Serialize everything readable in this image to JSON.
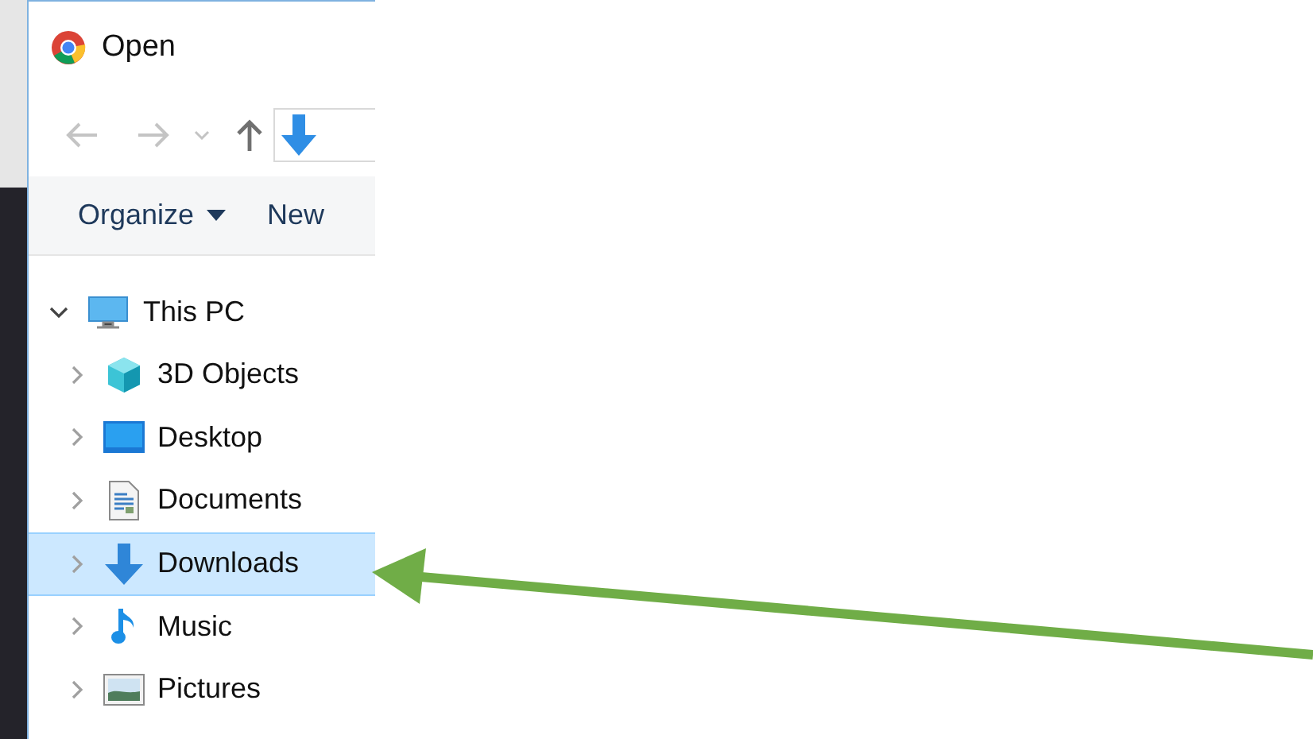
{
  "window": {
    "title": "Open"
  },
  "toolbar": {
    "organize": "Organize",
    "new_folder": "New"
  },
  "tree": [
    {
      "label": "This PC",
      "expanded": true,
      "children": [
        {
          "label": "3D Objects",
          "expanded": false,
          "selected": false
        },
        {
          "label": "Desktop",
          "expanded": false,
          "selected": false
        },
        {
          "label": "Documents",
          "expanded": false,
          "selected": false
        },
        {
          "label": "Downloads",
          "expanded": false,
          "selected": true
        },
        {
          "label": "Music",
          "expanded": false,
          "selected": false
        },
        {
          "label": "Pictures",
          "expanded": false,
          "selected": false
        }
      ]
    }
  ]
}
